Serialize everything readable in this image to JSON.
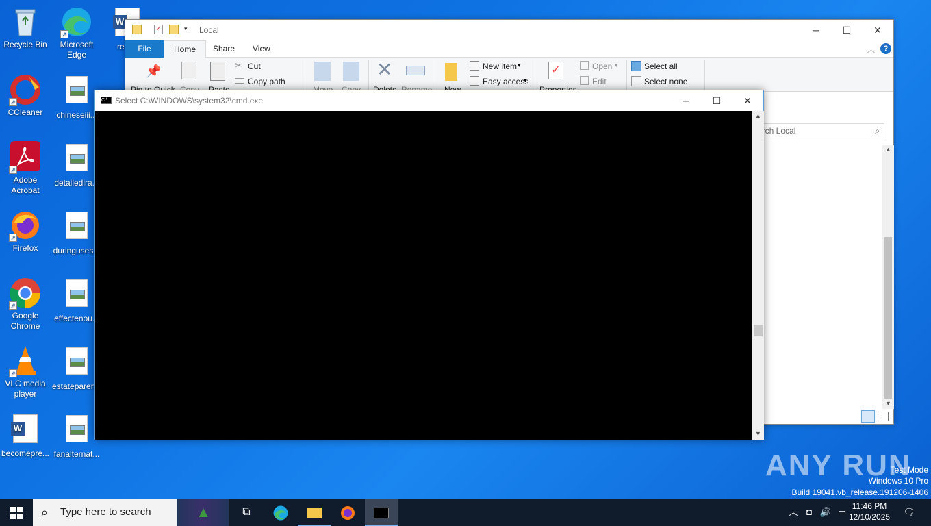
{
  "desktop": {
    "icons": [
      {
        "label": "Recycle Bin"
      },
      {
        "label": "Microsoft Edge"
      },
      {
        "label": "respo"
      },
      {
        "label": "CCleaner"
      },
      {
        "label": "chineseiii..."
      },
      {
        "label": "Adobe Acrobat"
      },
      {
        "label": "detailedira..."
      },
      {
        "label": "Firefox"
      },
      {
        "label": "duringuses..."
      },
      {
        "label": "Google Chrome"
      },
      {
        "label": "effectenou..."
      },
      {
        "label": "VLC media player"
      },
      {
        "label": "estateparen..."
      },
      {
        "label": "becomepre..."
      },
      {
        "label": "fanalternat..."
      }
    ]
  },
  "explorer": {
    "title": "Local",
    "tabs": [
      "File",
      "Home",
      "Share",
      "View"
    ],
    "ribbon": {
      "pin": "Pin to Quick",
      "copy": "Copy",
      "paste": "Paste",
      "cut": "Cut",
      "copy_path": "Copy path",
      "move": "Move",
      "copy_to": "Copy",
      "delete": "Delete",
      "rename": "Rename",
      "new_folder": "New",
      "new_item": "New item",
      "easy_access": "Easy access",
      "properties": "Properties",
      "open": "Open",
      "edit": "Edit",
      "select_all": "Select all",
      "select_none": "Select none"
    },
    "search_placeholder": "arch Local"
  },
  "cmd": {
    "title": "Select C:\\WINDOWS\\system32\\cmd.exe"
  },
  "watermark": {
    "brand": "ANY RUN",
    "test_mode": "Test Mode",
    "edition": "Windows 10 Pro",
    "build": "Build 19041.vb_release.191206-1406"
  },
  "taskbar": {
    "search_placeholder": "Type here to search",
    "time": "11:46 PM",
    "date": "12/10/2025"
  },
  "colors": {
    "accent": "#1979ca",
    "taskbar": "#101c2c",
    "desktop": "#0f73e3"
  }
}
